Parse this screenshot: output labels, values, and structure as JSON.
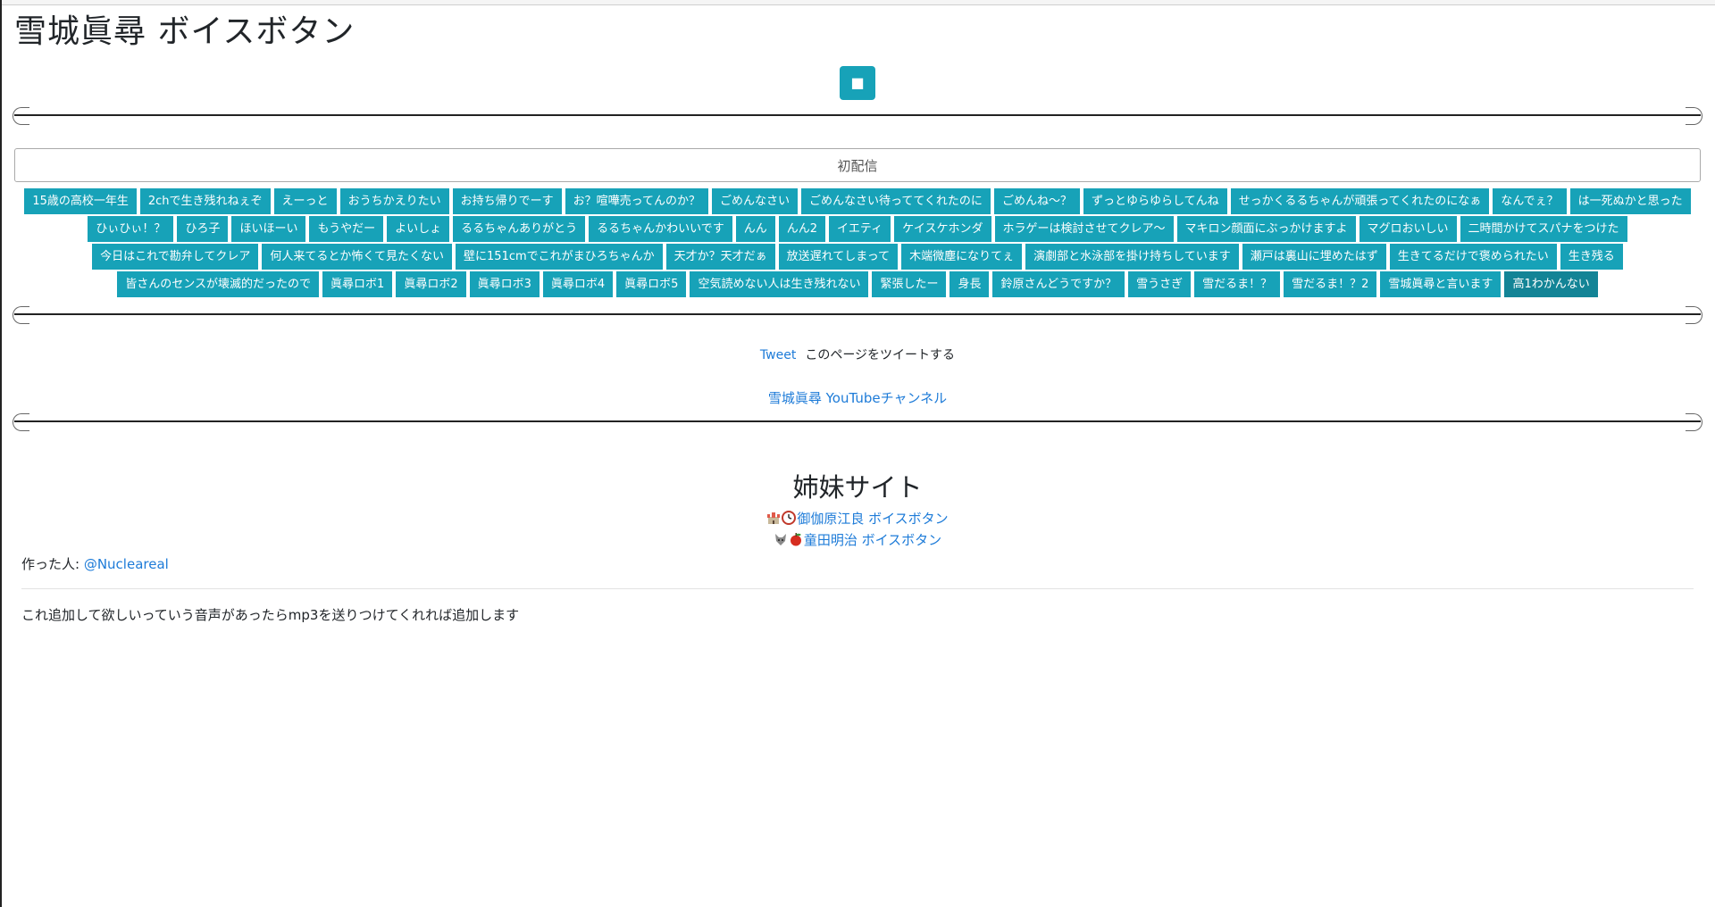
{
  "header": {
    "title": "雪城眞尋 ボイスボタン",
    "stop_label": "■"
  },
  "category": {
    "value": "初配信"
  },
  "voice_buttons": [
    "15歳の高校一年生",
    "2chで生き残れねぇぞ",
    "えーっと",
    "おうちかえりたい",
    "お持ち帰りでーす",
    "お？喧嘩売ってんのか？",
    "ごめんなさい",
    "ごめんなさい待っててくれたのに",
    "ごめんね～？",
    "ずっとゆらゆらしてんね",
    "せっかくるるちゃんが頑張ってくれたのになぁ",
    "なんでぇ？",
    "は一死ぬかと思った",
    "ひぃひぃ！？",
    "ひろ子",
    "ほいほーい",
    "もうやだー",
    "よいしょ",
    "るるちゃんありがとう",
    "るるちゃんかわいいです",
    "んん",
    "んん2",
    "イエティ",
    "ケイスケホンダ",
    "ホラゲーは検討させてクレア～",
    "マキロン顔面にぶっかけますよ",
    "マグロおいしい",
    "二時間かけてスパナをつけた",
    "今日はこれで勘弁してクレア",
    "何人来てるとか怖くて見たくない",
    "壁に151cmでこれがまひろちゃんか",
    "天才か？天才だぁ",
    "放送遅れてしまって",
    "木端微塵になりてぇ",
    "演劇部と水泳部を掛け持ちしています",
    "瀬戸は裏山に埋めたはず",
    "生きてるだけで褒められたい",
    "生き残る",
    "皆さんのセンスが壊滅的だったので",
    "眞尋ロボ1",
    "眞尋ロボ2",
    "眞尋ロボ3",
    "眞尋ロボ4",
    "眞尋ロボ5",
    "空気読めない人は生き残れない",
    "緊張したー",
    "身長",
    "鈴原さんどうですか？",
    "雪うさぎ",
    "雪だるま！？",
    "雪だるま！？2",
    "雪城眞尋と言います",
    "高1わかんない"
  ],
  "active_button_index": 52,
  "tweet": {
    "link_label": "Tweet",
    "text": "このページをツイートする"
  },
  "youtube": {
    "label": "雪城眞尋 YouTubeチャンネル"
  },
  "sister": {
    "heading": "姉妹サイト",
    "sites": [
      {
        "emoji1": "castle-icon",
        "emoji2": "clock-icon",
        "label": "御伽原江良 ボイスボタン"
      },
      {
        "emoji1": "wolf-icon",
        "emoji2": "apple-icon",
        "label": "童田明治 ボイスボタン"
      }
    ]
  },
  "author": {
    "prefix": "作った人: ",
    "handle": "@Nucleareal"
  },
  "note": "これ追加して欲しいっていう音声があったらmp3を送りつけてくれれば追加します",
  "colors": {
    "button": "#17a2b8",
    "button_active": "#138496",
    "link": "#1d7bd8"
  }
}
